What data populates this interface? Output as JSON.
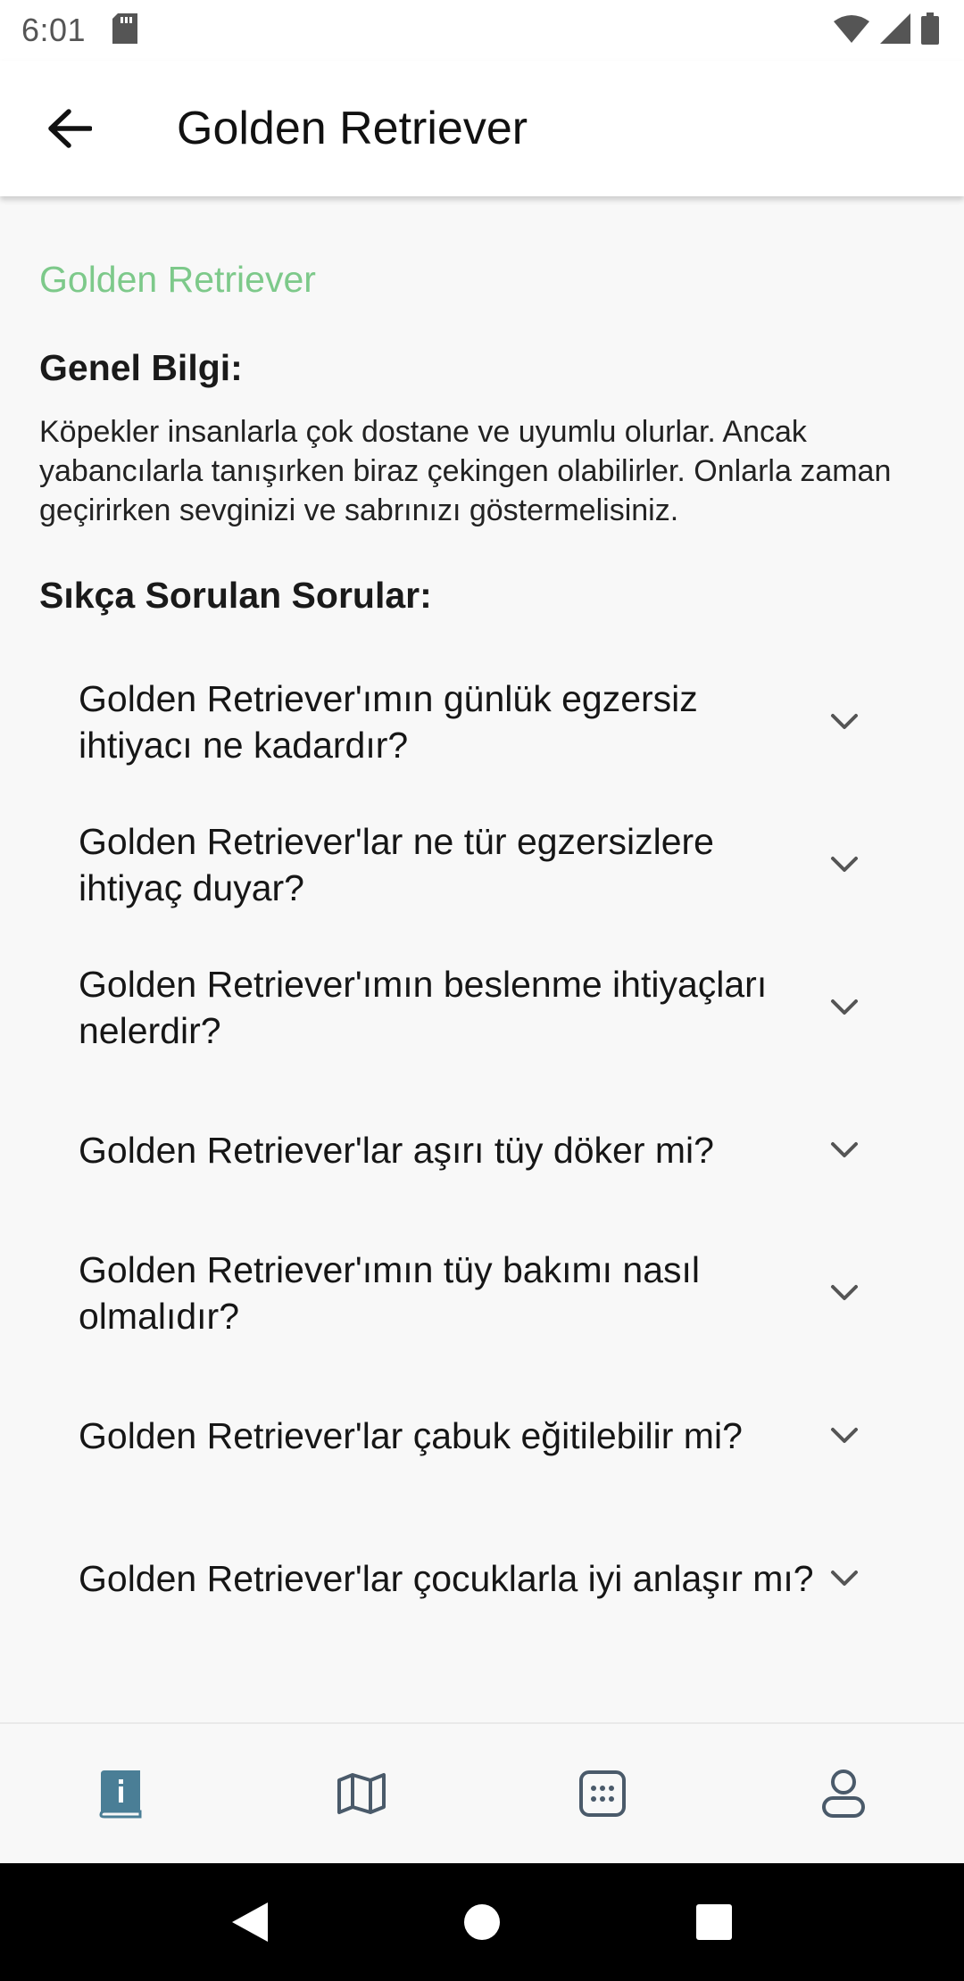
{
  "status_bar": {
    "time": "6:01",
    "icons": [
      "sd-card-icon",
      "wifi-icon",
      "signal-icon",
      "battery-icon"
    ]
  },
  "app_bar": {
    "back_icon": "arrow-left-icon",
    "title": "Golden Retriever"
  },
  "content": {
    "breed_name": "Golden Retriever",
    "general_heading": "Genel Bilgi:",
    "general_text": "Köpekler insanlarla çok dostane ve uyumlu olurlar. Ancak yabancılarla tanışırken biraz çekingen olabilirler. Onlarla zaman geçirirken sevginizi ve sabrınızı göstermelisiniz.",
    "faq_heading": "Sıkça Sorulan Sorular:",
    "faq": [
      {
        "question": "Golden Retriever'ımın günlük egzersiz ihtiyacı ne kadardır?"
      },
      {
        "question": "Golden Retriever'lar ne tür egzersizlere ihtiyaç duyar?"
      },
      {
        "question": "Golden Retriever'ımın beslenme ihtiyaçları nelerdir?"
      },
      {
        "question": "Golden Retriever'lar aşırı tüy döker mi?"
      },
      {
        "question": "Golden Retriever'ımın tüy bakımı nasıl olmalıdır?"
      },
      {
        "question": "Golden Retriever'lar çabuk eğitilebilir mi?"
      },
      {
        "question": "Golden Retriever'lar çocuklarla iyi anlaşır mı?"
      }
    ]
  },
  "bottom_nav": {
    "items": [
      {
        "icon": "info-book-icon",
        "active": true
      },
      {
        "icon": "map-icon",
        "active": false
      },
      {
        "icon": "calendar-grid-icon",
        "active": false
      },
      {
        "icon": "profile-icon",
        "active": false
      }
    ],
    "active_color": "#4a7e96",
    "inactive_color": "#4a5a6a"
  },
  "colors": {
    "accent_green": "#7dc98a",
    "background": "#f8f8f8"
  }
}
